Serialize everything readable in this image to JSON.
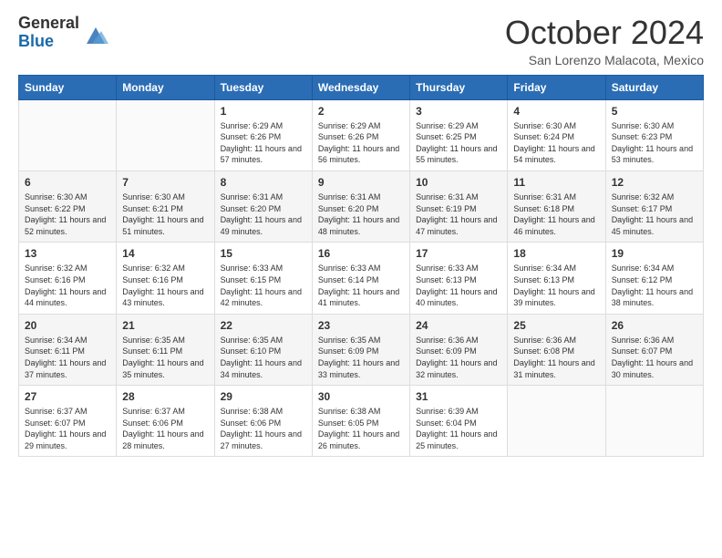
{
  "logo": {
    "general": "General",
    "blue": "Blue"
  },
  "title": "October 2024",
  "subtitle": "San Lorenzo Malacota, Mexico",
  "days_of_week": [
    "Sunday",
    "Monday",
    "Tuesday",
    "Wednesday",
    "Thursday",
    "Friday",
    "Saturday"
  ],
  "weeks": [
    [
      {
        "day": "",
        "sunrise": "",
        "sunset": "",
        "daylight": ""
      },
      {
        "day": "",
        "sunrise": "",
        "sunset": "",
        "daylight": ""
      },
      {
        "day": "1",
        "sunrise": "Sunrise: 6:29 AM",
        "sunset": "Sunset: 6:26 PM",
        "daylight": "Daylight: 11 hours and 57 minutes."
      },
      {
        "day": "2",
        "sunrise": "Sunrise: 6:29 AM",
        "sunset": "Sunset: 6:26 PM",
        "daylight": "Daylight: 11 hours and 56 minutes."
      },
      {
        "day": "3",
        "sunrise": "Sunrise: 6:29 AM",
        "sunset": "Sunset: 6:25 PM",
        "daylight": "Daylight: 11 hours and 55 minutes."
      },
      {
        "day": "4",
        "sunrise": "Sunrise: 6:30 AM",
        "sunset": "Sunset: 6:24 PM",
        "daylight": "Daylight: 11 hours and 54 minutes."
      },
      {
        "day": "5",
        "sunrise": "Sunrise: 6:30 AM",
        "sunset": "Sunset: 6:23 PM",
        "daylight": "Daylight: 11 hours and 53 minutes."
      }
    ],
    [
      {
        "day": "6",
        "sunrise": "Sunrise: 6:30 AM",
        "sunset": "Sunset: 6:22 PM",
        "daylight": "Daylight: 11 hours and 52 minutes."
      },
      {
        "day": "7",
        "sunrise": "Sunrise: 6:30 AM",
        "sunset": "Sunset: 6:21 PM",
        "daylight": "Daylight: 11 hours and 51 minutes."
      },
      {
        "day": "8",
        "sunrise": "Sunrise: 6:31 AM",
        "sunset": "Sunset: 6:20 PM",
        "daylight": "Daylight: 11 hours and 49 minutes."
      },
      {
        "day": "9",
        "sunrise": "Sunrise: 6:31 AM",
        "sunset": "Sunset: 6:20 PM",
        "daylight": "Daylight: 11 hours and 48 minutes."
      },
      {
        "day": "10",
        "sunrise": "Sunrise: 6:31 AM",
        "sunset": "Sunset: 6:19 PM",
        "daylight": "Daylight: 11 hours and 47 minutes."
      },
      {
        "day": "11",
        "sunrise": "Sunrise: 6:31 AM",
        "sunset": "Sunset: 6:18 PM",
        "daylight": "Daylight: 11 hours and 46 minutes."
      },
      {
        "day": "12",
        "sunrise": "Sunrise: 6:32 AM",
        "sunset": "Sunset: 6:17 PM",
        "daylight": "Daylight: 11 hours and 45 minutes."
      }
    ],
    [
      {
        "day": "13",
        "sunrise": "Sunrise: 6:32 AM",
        "sunset": "Sunset: 6:16 PM",
        "daylight": "Daylight: 11 hours and 44 minutes."
      },
      {
        "day": "14",
        "sunrise": "Sunrise: 6:32 AM",
        "sunset": "Sunset: 6:16 PM",
        "daylight": "Daylight: 11 hours and 43 minutes."
      },
      {
        "day": "15",
        "sunrise": "Sunrise: 6:33 AM",
        "sunset": "Sunset: 6:15 PM",
        "daylight": "Daylight: 11 hours and 42 minutes."
      },
      {
        "day": "16",
        "sunrise": "Sunrise: 6:33 AM",
        "sunset": "Sunset: 6:14 PM",
        "daylight": "Daylight: 11 hours and 41 minutes."
      },
      {
        "day": "17",
        "sunrise": "Sunrise: 6:33 AM",
        "sunset": "Sunset: 6:13 PM",
        "daylight": "Daylight: 11 hours and 40 minutes."
      },
      {
        "day": "18",
        "sunrise": "Sunrise: 6:34 AM",
        "sunset": "Sunset: 6:13 PM",
        "daylight": "Daylight: 11 hours and 39 minutes."
      },
      {
        "day": "19",
        "sunrise": "Sunrise: 6:34 AM",
        "sunset": "Sunset: 6:12 PM",
        "daylight": "Daylight: 11 hours and 38 minutes."
      }
    ],
    [
      {
        "day": "20",
        "sunrise": "Sunrise: 6:34 AM",
        "sunset": "Sunset: 6:11 PM",
        "daylight": "Daylight: 11 hours and 37 minutes."
      },
      {
        "day": "21",
        "sunrise": "Sunrise: 6:35 AM",
        "sunset": "Sunset: 6:11 PM",
        "daylight": "Daylight: 11 hours and 35 minutes."
      },
      {
        "day": "22",
        "sunrise": "Sunrise: 6:35 AM",
        "sunset": "Sunset: 6:10 PM",
        "daylight": "Daylight: 11 hours and 34 minutes."
      },
      {
        "day": "23",
        "sunrise": "Sunrise: 6:35 AM",
        "sunset": "Sunset: 6:09 PM",
        "daylight": "Daylight: 11 hours and 33 minutes."
      },
      {
        "day": "24",
        "sunrise": "Sunrise: 6:36 AM",
        "sunset": "Sunset: 6:09 PM",
        "daylight": "Daylight: 11 hours and 32 minutes."
      },
      {
        "day": "25",
        "sunrise": "Sunrise: 6:36 AM",
        "sunset": "Sunset: 6:08 PM",
        "daylight": "Daylight: 11 hours and 31 minutes."
      },
      {
        "day": "26",
        "sunrise": "Sunrise: 6:36 AM",
        "sunset": "Sunset: 6:07 PM",
        "daylight": "Daylight: 11 hours and 30 minutes."
      }
    ],
    [
      {
        "day": "27",
        "sunrise": "Sunrise: 6:37 AM",
        "sunset": "Sunset: 6:07 PM",
        "daylight": "Daylight: 11 hours and 29 minutes."
      },
      {
        "day": "28",
        "sunrise": "Sunrise: 6:37 AM",
        "sunset": "Sunset: 6:06 PM",
        "daylight": "Daylight: 11 hours and 28 minutes."
      },
      {
        "day": "29",
        "sunrise": "Sunrise: 6:38 AM",
        "sunset": "Sunset: 6:06 PM",
        "daylight": "Daylight: 11 hours and 27 minutes."
      },
      {
        "day": "30",
        "sunrise": "Sunrise: 6:38 AM",
        "sunset": "Sunset: 6:05 PM",
        "daylight": "Daylight: 11 hours and 26 minutes."
      },
      {
        "day": "31",
        "sunrise": "Sunrise: 6:39 AM",
        "sunset": "Sunset: 6:04 PM",
        "daylight": "Daylight: 11 hours and 25 minutes."
      },
      {
        "day": "",
        "sunrise": "",
        "sunset": "",
        "daylight": ""
      },
      {
        "day": "",
        "sunrise": "",
        "sunset": "",
        "daylight": ""
      }
    ]
  ]
}
